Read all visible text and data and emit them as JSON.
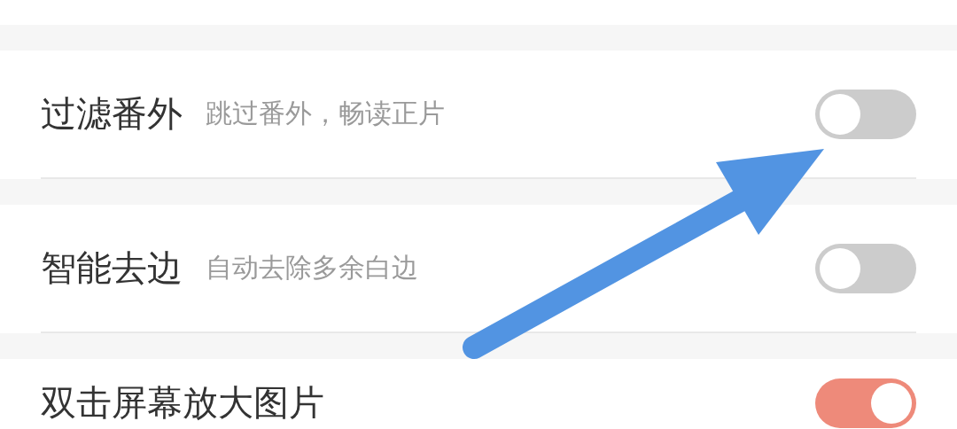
{
  "settings": [
    {
      "title": "过滤番外",
      "subtitle": "跳过番外，畅读正片",
      "on": false
    },
    {
      "title": "智能去边",
      "subtitle": "自动去除多余白边",
      "on": false
    },
    {
      "title": "双击屏幕放大图片",
      "on": true
    }
  ]
}
